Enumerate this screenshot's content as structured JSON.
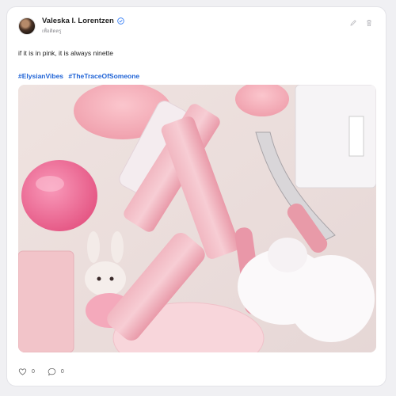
{
  "post": {
    "author": {
      "display_name": "Valeska I. Lorentzen",
      "handle": "เพื่อติดตรู",
      "verified_icon": "verified-badge-icon"
    },
    "text": "if it is in pink, it is always ninette",
    "hashtags": [
      "#ElysianVibes",
      "#TheTraceOfSomeone"
    ],
    "image_alt_icon": "photo-of-pink-makeup",
    "actions": {
      "edit_icon": "pencil-icon",
      "delete_icon": "trash-icon"
    },
    "stats": {
      "likes": "0",
      "comments": "0"
    }
  },
  "colors": {
    "accent": "#1f63d6",
    "verified": "#3b82f6"
  }
}
